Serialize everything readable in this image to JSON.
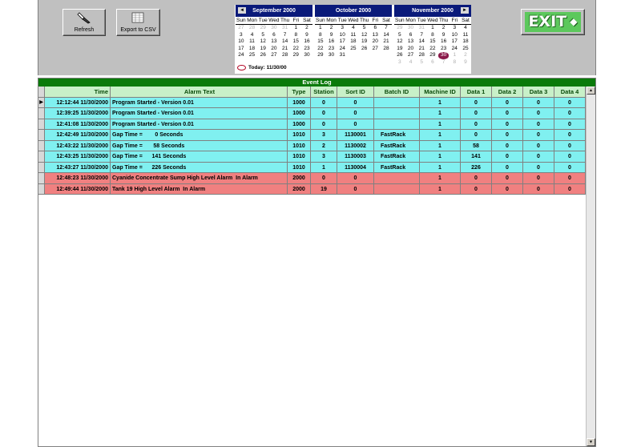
{
  "toolbar": {
    "refresh_label": "Refresh",
    "export_label": "Export to CSV",
    "exit_label": "EXIT"
  },
  "calendar": {
    "dow": [
      "Sun",
      "Mon",
      "Tue",
      "Wed",
      "Thu",
      "Fri",
      "Sat"
    ],
    "today_label": "Today: 11/30/00",
    "months": [
      {
        "title": "September 2000",
        "cells": [
          "27",
          "28",
          "29",
          "30",
          "31",
          "1",
          "2",
          "3",
          "4",
          "5",
          "6",
          "7",
          "8",
          "9",
          "10",
          "11",
          "12",
          "13",
          "14",
          "15",
          "16",
          "17",
          "18",
          "19",
          "20",
          "21",
          "22",
          "23",
          "24",
          "25",
          "26",
          "27",
          "28",
          "29",
          "30"
        ],
        "dim_before": 5,
        "dim_after": 0
      },
      {
        "title": "October 2000",
        "cells": [
          "1",
          "2",
          "3",
          "4",
          "5",
          "6",
          "7",
          "8",
          "9",
          "10",
          "11",
          "12",
          "13",
          "14",
          "15",
          "16",
          "17",
          "18",
          "19",
          "20",
          "21",
          "22",
          "23",
          "24",
          "25",
          "26",
          "27",
          "28",
          "29",
          "30",
          "31"
        ],
        "dim_before": 0,
        "dim_after": 0
      },
      {
        "title": "November 2000",
        "cells": [
          "29",
          "30",
          "31",
          "1",
          "2",
          "3",
          "4",
          "5",
          "6",
          "7",
          "8",
          "9",
          "10",
          "11",
          "12",
          "13",
          "14",
          "15",
          "16",
          "17",
          "18",
          "19",
          "20",
          "21",
          "22",
          "23",
          "24",
          "25",
          "26",
          "27",
          "28",
          "29",
          "30",
          "1",
          "2",
          "3",
          "4",
          "5",
          "6",
          "7",
          "8",
          "9"
        ],
        "dim_before": 3,
        "dim_after": 9,
        "today_day": "30"
      }
    ]
  },
  "event_log": {
    "title": "Event Log",
    "columns": [
      "Time",
      "Alarm Text",
      "Type",
      "Station",
      "Sort ID",
      "Batch ID",
      "Machine ID",
      "Data 1",
      "Data 2",
      "Data 3",
      "Data 4"
    ],
    "rows": [
      {
        "status": "cyan",
        "cells": [
          "12:12:44 11/30/2000",
          "Program Started - Version 0.01",
          "1000",
          "0",
          "0",
          "",
          "1",
          "0",
          "0",
          "0",
          "0"
        ]
      },
      {
        "status": "cyan",
        "cells": [
          "12:39:25 11/30/2000",
          "Program Started - Version 0.01",
          "1000",
          "0",
          "0",
          "",
          "1",
          "0",
          "0",
          "0",
          "0"
        ]
      },
      {
        "status": "cyan",
        "cells": [
          "12:41:08 11/30/2000",
          "Program Started - Version 0.01",
          "1000",
          "0",
          "0",
          "",
          "1",
          "0",
          "0",
          "0",
          "0"
        ]
      },
      {
        "status": "cyan",
        "cells": [
          "12:42:49 11/30/2000",
          "Gap Time =        0 Seconds",
          "1010",
          "3",
          "1130001",
          "FastRack",
          "1",
          "0",
          "0",
          "0",
          "0"
        ]
      },
      {
        "status": "cyan",
        "cells": [
          "12:43:22 11/30/2000",
          "Gap Time =       58 Seconds",
          "1010",
          "2",
          "1130002",
          "FastRack",
          "1",
          "58",
          "0",
          "0",
          "0"
        ]
      },
      {
        "status": "cyan",
        "cells": [
          "12:43:25 11/30/2000",
          "Gap Time =      141 Seconds",
          "1010",
          "3",
          "1130003",
          "FastRack",
          "1",
          "141",
          "0",
          "0",
          "0"
        ]
      },
      {
        "status": "cyan",
        "cells": [
          "12:43:27 11/30/2000",
          "Gap Time =      226 Seconds",
          "1010",
          "1",
          "1130004",
          "FastRack",
          "1",
          "226",
          "0",
          "0",
          "0"
        ]
      },
      {
        "status": "red",
        "cells": [
          "12:48:23 11/30/2000",
          "Cyanide Concentrate Sump High Level Alarm  In Alarm",
          "2000",
          "0",
          "0",
          "",
          "1",
          "0",
          "0",
          "0",
          "0"
        ]
      },
      {
        "status": "red",
        "cells": [
          "12:49:44 11/30/2000",
          "Tank 19 High Level Alarm  In Alarm",
          "2000",
          "19",
          "0",
          "",
          "1",
          "0",
          "0",
          "0",
          "0"
        ]
      }
    ],
    "colors": {
      "info": "#80f0f0",
      "alarm": "#f08080",
      "header": "#c8f0c8",
      "title_bar": "#0a7a0a"
    }
  }
}
